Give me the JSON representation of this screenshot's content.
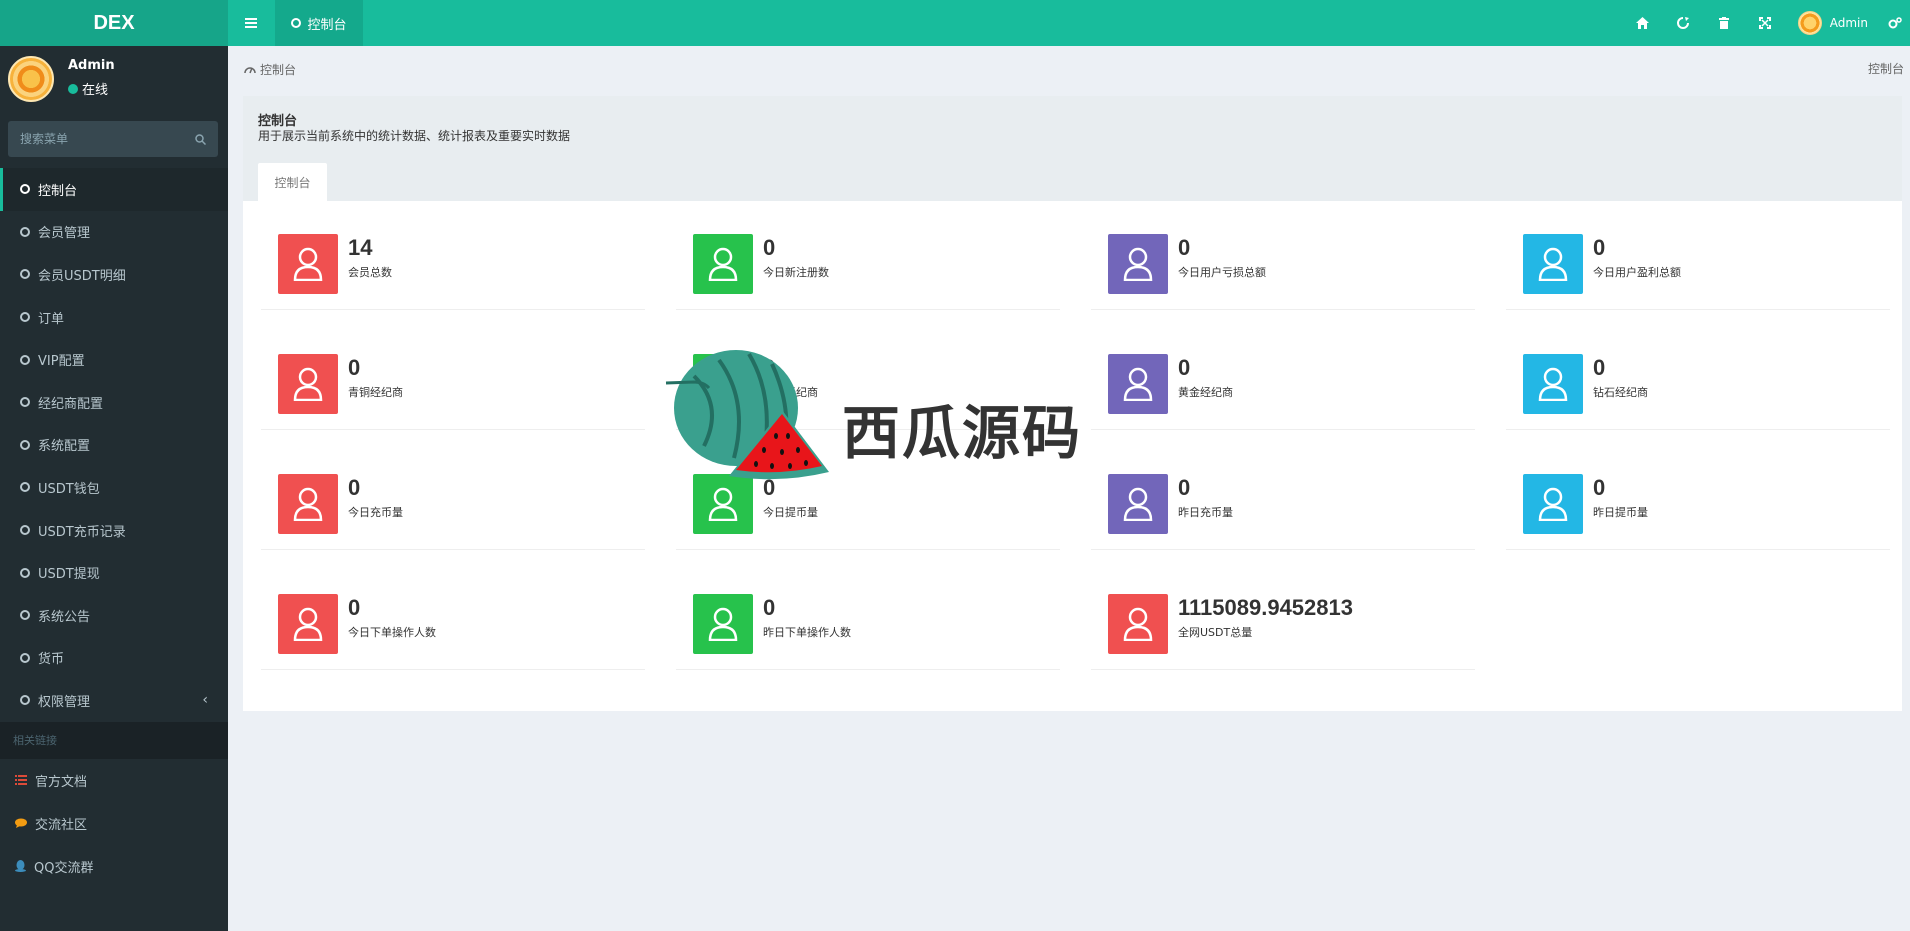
{
  "header": {
    "logo": "DEX",
    "active_tab": "控制台",
    "user_name": "Admin",
    "icons": [
      "home-icon",
      "refresh-icon",
      "trash-icon",
      "fullscreen-icon",
      "settings-icon"
    ]
  },
  "sidebar": {
    "user": {
      "name": "Admin",
      "status": "在线"
    },
    "search_placeholder": "搜索菜单",
    "items": [
      {
        "label": "控制台",
        "active": true
      },
      {
        "label": "会员管理"
      },
      {
        "label": "会员USDT明细"
      },
      {
        "label": "订单"
      },
      {
        "label": "VIP配置"
      },
      {
        "label": "经纪商配置"
      },
      {
        "label": "系统配置"
      },
      {
        "label": "USDT钱包"
      },
      {
        "label": "USDT充币记录"
      },
      {
        "label": "USDT提现"
      },
      {
        "label": "系统公告"
      },
      {
        "label": "货币"
      },
      {
        "label": "权限管理"
      }
    ],
    "links_header": "相关链接",
    "links": [
      {
        "label": "官方文档",
        "icon": "list-icon",
        "color": "#dd4b39"
      },
      {
        "label": "交流社区",
        "icon": "comment-icon",
        "color": "#f39c12"
      },
      {
        "label": "QQ交流群",
        "icon": "qq-icon",
        "color": "#3c8dbc"
      }
    ]
  },
  "breadcrumb": {
    "left": "控制台",
    "right": "控制台"
  },
  "panel": {
    "title": "控制台",
    "description": "用于展示当前系统中的统计数据、统计报表及重要实时数据",
    "tab": "控制台"
  },
  "colors": {
    "red": "#f05050",
    "green": "#27c24c",
    "purple": "#7266ba",
    "blue": "#23b7e5"
  },
  "stats": [
    {
      "value": "14",
      "label": "会员总数",
      "color": "red"
    },
    {
      "value": "0",
      "label": "今日新注册数",
      "color": "green"
    },
    {
      "value": "0",
      "label": "今日用户亏损总额",
      "color": "purple"
    },
    {
      "value": "0",
      "label": "今日用户盈利总额",
      "color": "blue"
    },
    {
      "value": "0",
      "label": "青铜经纪商",
      "color": "red"
    },
    {
      "value": "0",
      "label": "白银经纪商",
      "color": "green"
    },
    {
      "value": "0",
      "label": "黄金经纪商",
      "color": "purple"
    },
    {
      "value": "0",
      "label": "钻石经纪商",
      "color": "blue"
    },
    {
      "value": "0",
      "label": "今日充币量",
      "color": "red"
    },
    {
      "value": "0",
      "label": "今日提币量",
      "color": "green"
    },
    {
      "value": "0",
      "label": "昨日充币量",
      "color": "purple"
    },
    {
      "value": "0",
      "label": "昨日提币量",
      "color": "blue"
    },
    {
      "value": "0",
      "label": "今日下单操作人数",
      "color": "red"
    },
    {
      "value": "0",
      "label": "昨日下单操作人数",
      "color": "green"
    },
    {
      "value": "1115089.9452813",
      "label": "全网USDT总量",
      "color": "red"
    }
  ],
  "watermark": "西瓜源码"
}
